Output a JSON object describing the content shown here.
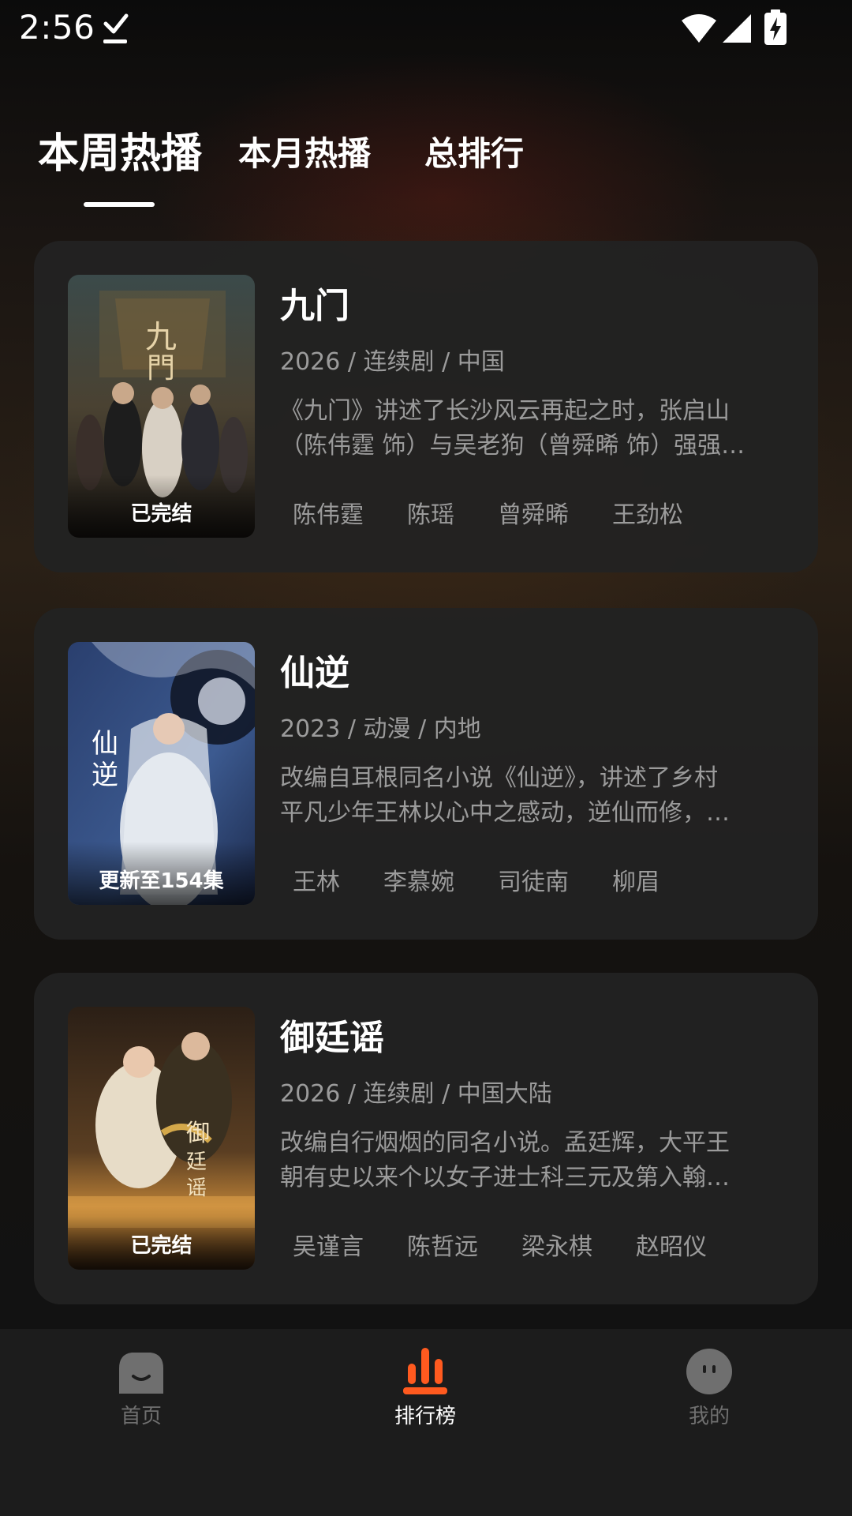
{
  "status_bar": {
    "time": "2:56"
  },
  "tabs": [
    {
      "label": "本周热播",
      "active": true
    },
    {
      "label": "本月热播",
      "active": false
    },
    {
      "label": "总排行",
      "active": false
    }
  ],
  "items": [
    {
      "title": "九门",
      "meta": "2026 / 连续剧 / 中国",
      "description": [
        "《九门》讲述了长沙风云再起之时，张启山",
        "（陈伟霆 饰）与吴老狗（曾舜晞 饰）强强…"
      ],
      "badge": "已完结",
      "actors": [
        "陈伟霆",
        "陈瑶",
        "曾舜晞",
        "王劲松"
      ]
    },
    {
      "title": "仙逆",
      "meta": "2023 / 动漫 / 内地",
      "description": [
        "改编自耳根同名小说《仙逆》，讲述了乡村",
        "平凡少年王林以心中之感动，逆仙而修，…"
      ],
      "badge": "更新至154集",
      "actors": [
        "王林",
        "李慕婉",
        "司徒南",
        "柳眉"
      ]
    },
    {
      "title": "御廷谣",
      "meta": "2026 / 连续剧 / 中国大陆",
      "description": [
        "改编自行烟烟的同名小说。孟廷辉，大平王",
        "朝有史以来个以女子进士科三元及第入翰…"
      ],
      "badge": "已完结",
      "actors": [
        "吴谨言",
        "陈哲远",
        "梁永棋",
        "赵昭仪"
      ]
    }
  ],
  "bottom_nav": [
    {
      "label": "首页",
      "icon": "home-icon",
      "active": false
    },
    {
      "label": "排行榜",
      "icon": "ranking-icon",
      "active": true
    },
    {
      "label": "我的",
      "icon": "profile-icon",
      "active": false
    }
  ],
  "colors": {
    "accent": "#FF5A1F",
    "card_bg": "#222222",
    "secondary_text": "#9B9B9B",
    "nav_inactive": "#6F6F6F"
  }
}
